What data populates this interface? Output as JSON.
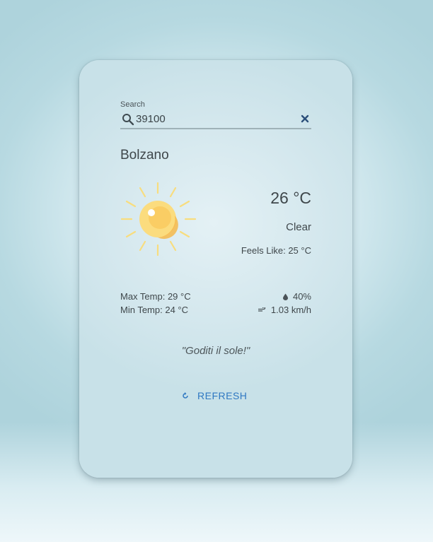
{
  "search": {
    "label": "Search",
    "value": "39100"
  },
  "weather": {
    "city": "Bolzano",
    "temperature": "26 °C",
    "condition": "Clear",
    "feels_like": "Feels Like: 25 °C",
    "max_temp": "Max Temp: 29 °C",
    "min_temp": "Min Temp: 24 °C",
    "humidity": "40%",
    "wind": "1.03 km/h",
    "icon": "sun-icon"
  },
  "quote": "\"Goditi il sole!\"",
  "actions": {
    "refresh_label": "REFRESH"
  },
  "colors": {
    "accent": "#2f78c2",
    "clear_icon": "#2b4f7a",
    "sun_core": "#fbd772",
    "sun_rays": "#f8dd7e"
  }
}
